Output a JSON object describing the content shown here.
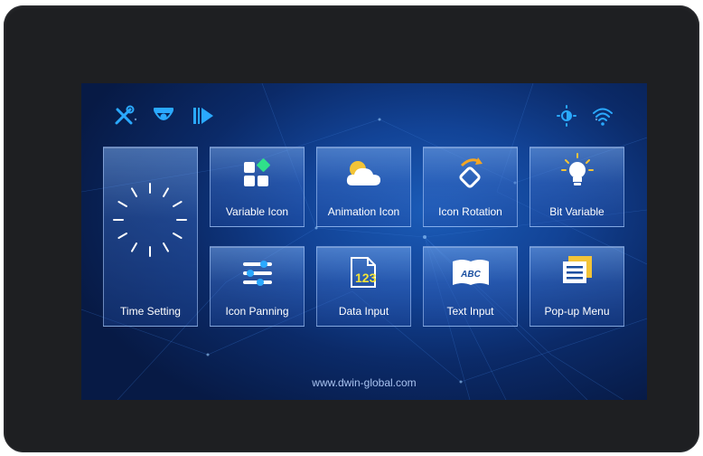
{
  "footer": {
    "url": "www.dwin-global.com"
  },
  "tiles": {
    "time_setting": "Time Setting",
    "variable_icon": "Variable Icon",
    "animation_icon": "Animation Icon",
    "icon_rotation": "Icon Rotation",
    "bit_variable": "Bit Variable",
    "icon_panning": "Icon Panning",
    "data_input": "Data Input",
    "text_input": "Text Input",
    "popup_menu": "Pop-up Menu"
  },
  "icons": {
    "text_input_glyph": "ABC",
    "data_input_glyph": "123"
  },
  "status_icons": [
    "wrench-screwdriver-icon",
    "camera-icon",
    "play-icon",
    "brightness-icon",
    "wifi-icon"
  ],
  "colors": {
    "accent_blue": "#2aa9ff",
    "screen_bg": "#0b2a68",
    "bezel": "#1e1f22"
  }
}
